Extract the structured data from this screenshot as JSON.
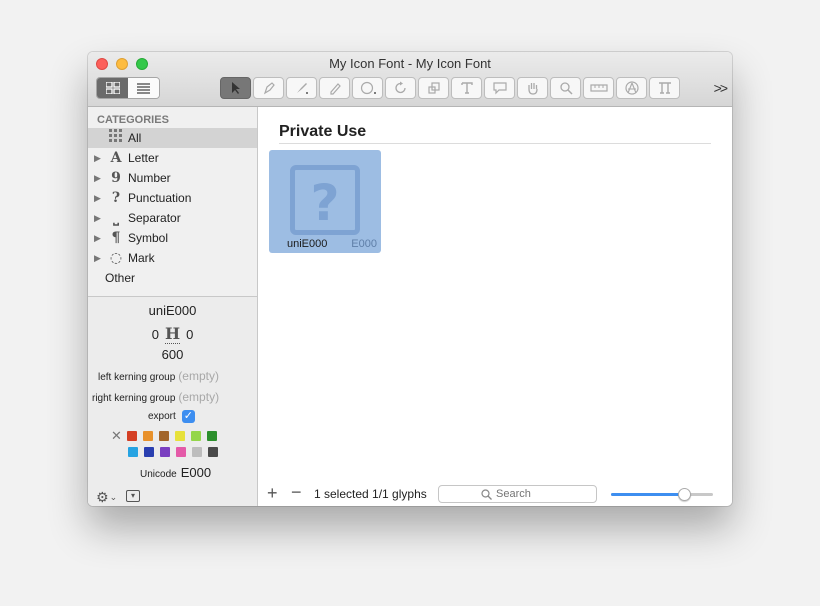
{
  "window": {
    "title": "My Icon Font - My Icon Font"
  },
  "toolbar": {
    "tools": [
      "select-tool",
      "pen-tool",
      "draw-tool",
      "pencil-tool",
      "primitives-tool",
      "rotate-tool",
      "scale-tool",
      "text-tool",
      "annotation-tool",
      "hand-tool",
      "zoom-tool",
      "measurement-tool",
      "anchor-tool",
      "hints-tool"
    ],
    "more_label": ">>"
  },
  "sidebar": {
    "header": "CATEGORIES",
    "categories": [
      {
        "label": "All",
        "icon": "grid-dots-icon",
        "glyph": "",
        "selected": true,
        "expandable": false
      },
      {
        "label": "Letter",
        "icon": "letter-icon",
        "glyph": "A",
        "selected": false,
        "expandable": true
      },
      {
        "label": "Number",
        "icon": "number-icon",
        "glyph": "9",
        "selected": false,
        "expandable": true
      },
      {
        "label": "Punctuation",
        "icon": "punctuation-icon",
        "glyph": "?",
        "selected": false,
        "expandable": true
      },
      {
        "label": "Separator",
        "icon": "separator-icon",
        "glyph": "⎵",
        "selected": false,
        "expandable": true
      },
      {
        "label": "Symbol",
        "icon": "symbol-icon",
        "glyph": "¶",
        "selected": false,
        "expandable": true
      },
      {
        "label": "Mark",
        "icon": "mark-icon",
        "glyph": "◌",
        "selected": false,
        "expandable": true
      },
      {
        "label": "Other",
        "icon": "",
        "glyph": "",
        "selected": false,
        "expandable": false
      }
    ]
  },
  "info": {
    "glyph_name": "uniE000",
    "lsb": "0",
    "rsb": "0",
    "width": "600",
    "left_kerning_label": "left kerning group",
    "right_kerning_label": "right kerning group",
    "empty_placeholder": "(empty)",
    "export_label": "export",
    "export_checked": true,
    "colors_row1": [
      "#d43f24",
      "#e8912b",
      "#a2652b",
      "#e7e13a",
      "#94d64a",
      "#2c8f2c"
    ],
    "colors_row2": [
      "#26a3e2",
      "#2a3fb0",
      "#7a3fc0",
      "#e45aa8",
      "#bdbdbd",
      "#4a4a4a"
    ],
    "unicode_label": "Unicode",
    "unicode_value": "E000"
  },
  "main": {
    "section_title": "Private Use",
    "glyphs": [
      {
        "name": "uniE000",
        "code": "E000",
        "selected": true
      }
    ],
    "status": "1 selected 1/1 glyphs",
    "search_placeholder": "Search",
    "zoom_level": 0.72
  }
}
